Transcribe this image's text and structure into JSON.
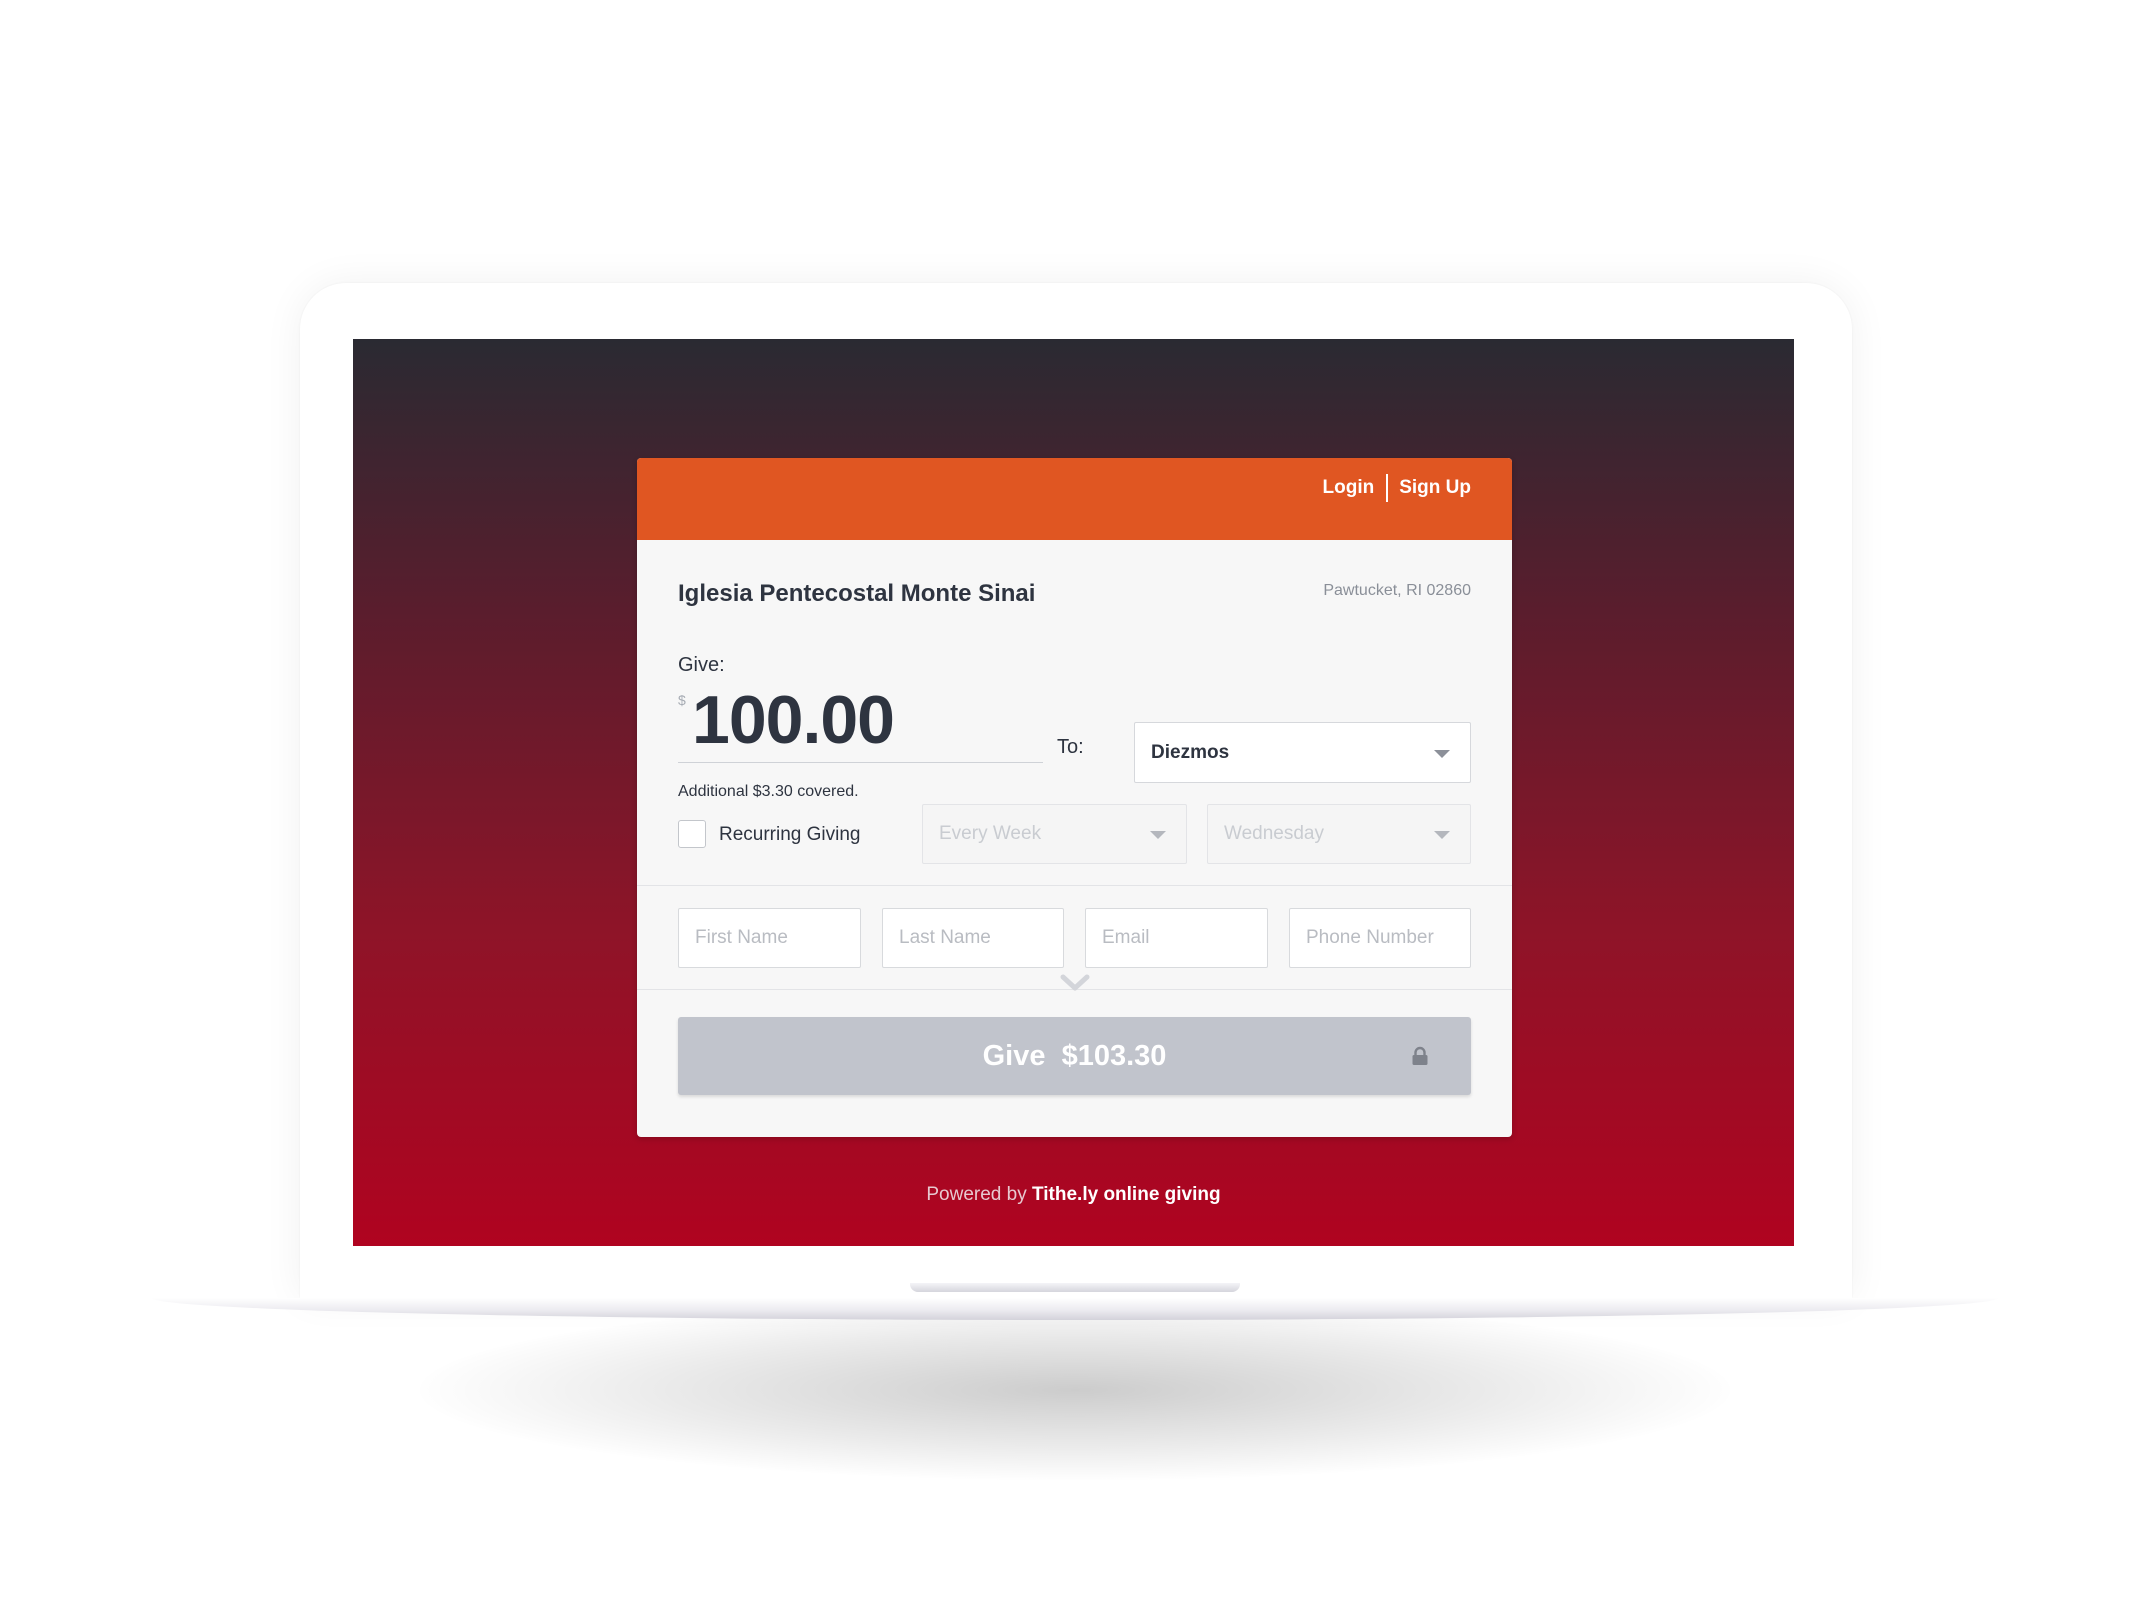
{
  "header": {
    "login_label": "Login",
    "signup_label": "Sign Up"
  },
  "church": {
    "name": "Iglesia Pentecostal Monte Sinai",
    "location": "Pawtucket, RI 02860"
  },
  "give": {
    "label": "Give:",
    "currency_symbol": "$",
    "amount": "100.00",
    "covered_text": "Additional $3.30 covered.",
    "to_label": "To:",
    "fund_selected": "Diezmos"
  },
  "recurring": {
    "label": "Recurring Giving",
    "checked": false,
    "frequency_placeholder": "Every Week",
    "day_placeholder": "Wednesday"
  },
  "donor_fields": {
    "first_name_placeholder": "First Name",
    "last_name_placeholder": "Last Name",
    "email_placeholder": "Email",
    "phone_placeholder": "Phone Number"
  },
  "submit": {
    "label": "Give",
    "total": "$103.30"
  },
  "footer": {
    "powered_prefix": "Powered by",
    "powered_brand": "Tithe.ly online giving"
  },
  "colors": {
    "header_accent": "#e05622",
    "button_disabled": "#c1c4cc",
    "screen_gradient_top": "#2a2a32",
    "screen_gradient_bottom": "#b00320"
  },
  "icons": [
    "chevron-down-icon",
    "caret-down-icon",
    "lock-icon"
  ]
}
